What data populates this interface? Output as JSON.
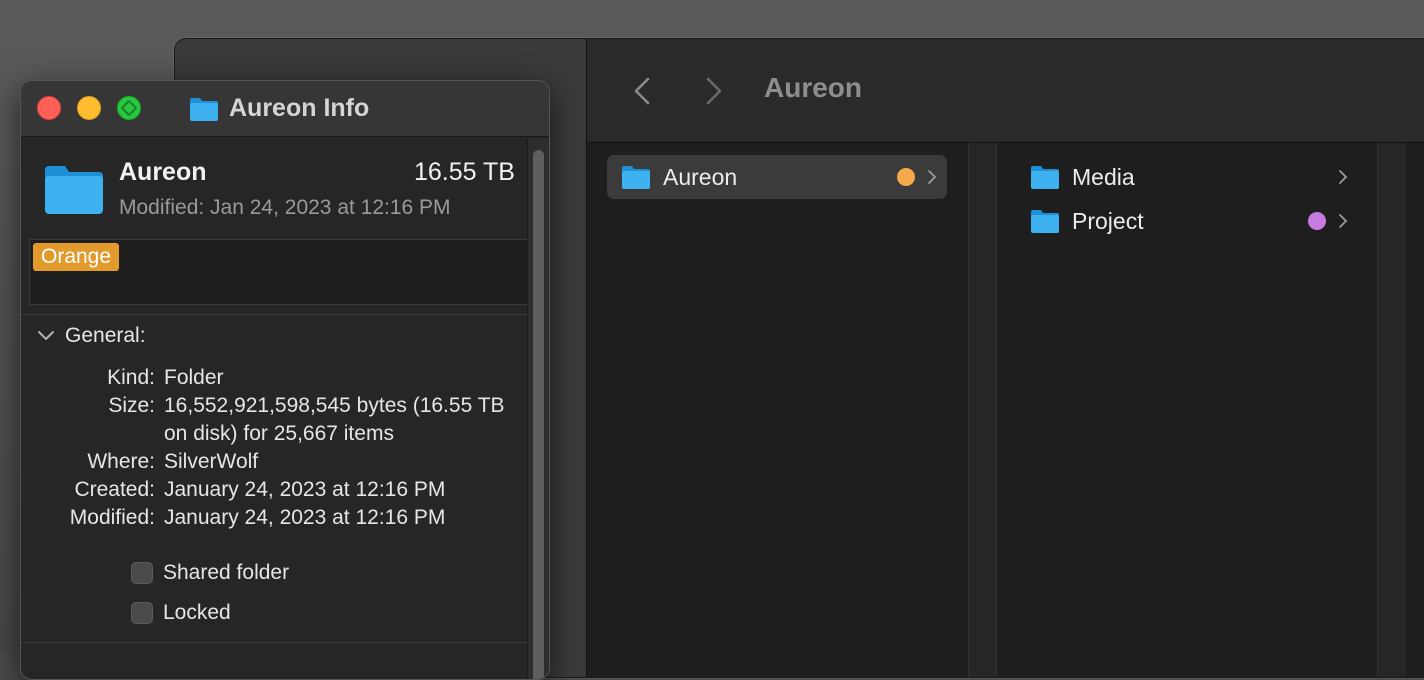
{
  "finder": {
    "toolbar_title": "Aureon",
    "column1": [
      {
        "label": "Aureon",
        "tag_color": "#f5a94a",
        "selected": true
      }
    ],
    "column2": [
      {
        "label": "Media",
        "tag_color": ""
      },
      {
        "label": "Project",
        "tag_color": "#c77ae0"
      }
    ]
  },
  "info": {
    "window_title": "Aureon Info",
    "name": "Aureon",
    "size": "16.55 TB",
    "modified_short": "Modified: Jan 24, 2023 at 12:16 PM",
    "tag": "Orange",
    "tag_color": "#e29a2d",
    "section_general": "General:",
    "fields": [
      {
        "key": "Kind:",
        "value": "Folder"
      },
      {
        "key": "Size:",
        "value": "16,552,921,598,545 bytes (16.55 TB on disk) for 25,667 items"
      },
      {
        "key": "Where:",
        "value": "SilverWolf"
      },
      {
        "key": "Created:",
        "value": "January 24, 2023 at 12:16 PM"
      },
      {
        "key": "Modified:",
        "value": "January 24, 2023 at 12:16 PM"
      }
    ],
    "checkboxes": [
      {
        "label": "Shared folder",
        "checked": false
      },
      {
        "label": "Locked",
        "checked": false
      }
    ]
  }
}
